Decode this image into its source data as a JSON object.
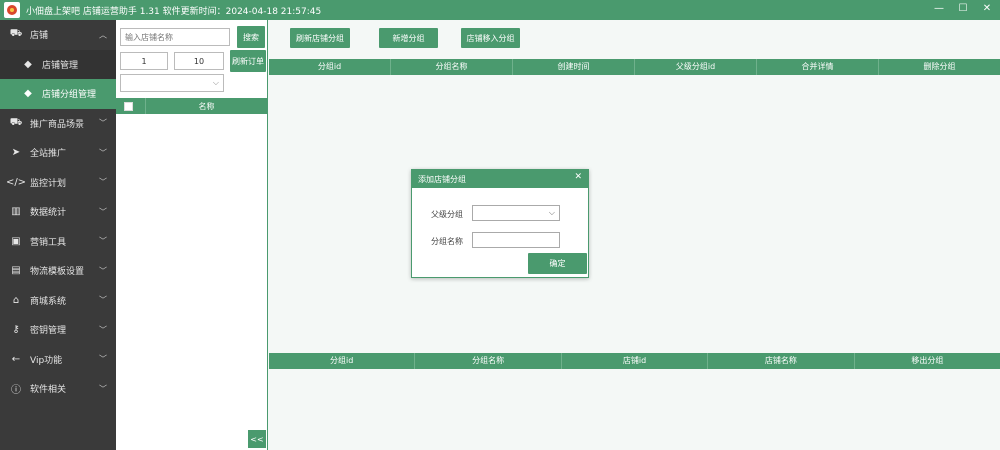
{
  "window": {
    "title": "小佃盘上架吧 店铺运营助手 1.31 软件更新时间：2024-04-18 21:57:45",
    "controls": {
      "minimize": "—",
      "maximize": "☐",
      "close": "✕"
    }
  },
  "sidebar": {
    "items": [
      {
        "label": "店铺",
        "icon": "car-icon",
        "glyph": "⛟",
        "expandable": true,
        "expanded": true
      },
      {
        "label": "店铺管理",
        "icon": "tag-icon",
        "glyph": "◆",
        "sub": true,
        "active": false
      },
      {
        "label": "店铺分组管理",
        "icon": "tag-icon",
        "glyph": "◆",
        "sub": true,
        "active": true
      },
      {
        "label": "推广商品场景",
        "icon": "car-icon",
        "glyph": "⛟",
        "expandable": true
      },
      {
        "label": "全站推广",
        "icon": "send-icon",
        "glyph": "➤",
        "expandable": true
      },
      {
        "label": "监控计划",
        "icon": "code-icon",
        "glyph": "</>",
        "expandable": true
      },
      {
        "label": "数据统计",
        "icon": "bar-chart-icon",
        "glyph": "▥",
        "expandable": true
      },
      {
        "label": "营销工具",
        "icon": "contact-icon",
        "glyph": "▣",
        "expandable": true
      },
      {
        "label": "物流模板设置",
        "icon": "briefcase-icon",
        "glyph": "▤",
        "expandable": true
      },
      {
        "label": "商城系统",
        "icon": "bank-icon",
        "glyph": "⌂",
        "expandable": true
      },
      {
        "label": "密钥管理",
        "icon": "key-icon",
        "glyph": "⚷",
        "expandable": true
      },
      {
        "label": "Vip功能",
        "icon": "arrow-left-icon",
        "glyph": "←",
        "expandable": true
      },
      {
        "label": "软件相关",
        "icon": "info-icon",
        "glyph": "ⓘ",
        "expandable": true
      }
    ]
  },
  "midpanel": {
    "search_placeholder": "输入店铺名称",
    "search_button": "搜索",
    "page_value": "1",
    "page_size": "10",
    "refresh_button": "刷新订单",
    "select_value": "",
    "table_header": "名称",
    "collapse_label": "<<"
  },
  "toolbar": {
    "refresh_groups": "刷新店铺分组",
    "add_group": "新增分组",
    "import_group": "店铺移入分组"
  },
  "group_table": {
    "columns": [
      "分组id",
      "分组名称",
      "创建时间",
      "父级分组id",
      "合并详情",
      "删除分组"
    ]
  },
  "shop_table": {
    "columns": [
      "分组id",
      "分组名称",
      "店铺id",
      "店铺名称",
      "移出分组"
    ]
  },
  "dialog": {
    "title": "添加店铺分组",
    "close": "✕",
    "parent_label": "父级分组",
    "parent_value": "",
    "name_label": "分组名称",
    "name_value": "",
    "confirm": "确定"
  }
}
